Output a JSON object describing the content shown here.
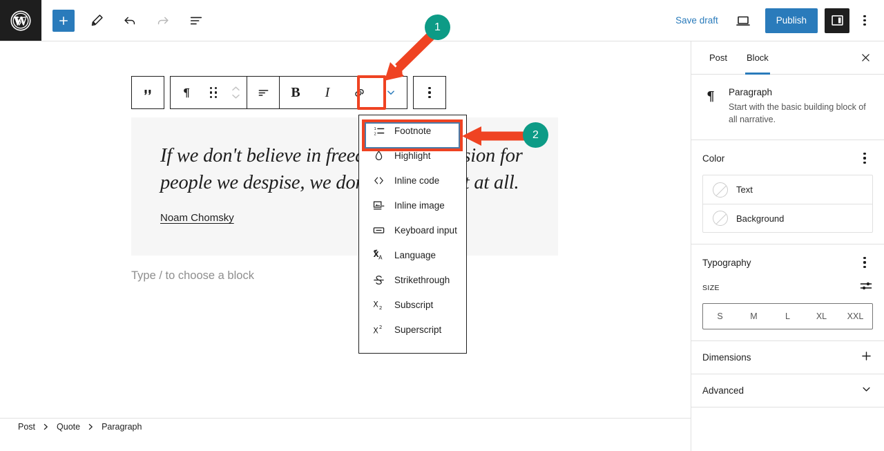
{
  "topbar": {
    "logo_icon": "wordpress-logo-icon",
    "add_block_label": "+",
    "tools": [
      {
        "name": "edit-tool",
        "icon": "pencil-icon"
      },
      {
        "name": "undo",
        "icon": "undo-arrow-icon"
      },
      {
        "name": "redo",
        "icon": "redo-arrow-icon"
      },
      {
        "name": "document-overview",
        "icon": "list-view-icon"
      }
    ],
    "save_draft_label": "Save draft",
    "preview_icon": "laptop-preview-icon",
    "publish_label": "Publish",
    "sidebar_toggle_icon": "settings-panel-icon",
    "options_icon": "kebab-vertical-icon"
  },
  "block_toolbar": {
    "parent_block_icon": "quote-icon",
    "block_type_icon": "paragraph-pilcrow-icon",
    "drag_icon": "drag-handle-icon",
    "movers_icon": "move-up-down-icon",
    "align_icon": "align-text-icon",
    "bold_label": "B",
    "italic_label": "I",
    "link_icon": "link-icon",
    "more_formats_icon": "chevron-down-icon",
    "options_icon": "kebab-vertical-icon"
  },
  "dropdown": {
    "items": [
      {
        "label": "Footnote",
        "icon": "ordered-list-icon",
        "selected": true
      },
      {
        "label": "Highlight",
        "icon": "droplet-icon",
        "selected": false
      },
      {
        "label": "Inline code",
        "icon": "angle-brackets-icon",
        "selected": false
      },
      {
        "label": "Inline image",
        "icon": "inline-image-icon",
        "selected": false
      },
      {
        "label": "Keyboard input",
        "icon": "keyboard-icon",
        "selected": false
      },
      {
        "label": "Language",
        "icon": "language-icon",
        "selected": false
      },
      {
        "label": "Strikethrough",
        "icon": "strikethrough-icon",
        "selected": false
      },
      {
        "label": "Subscript",
        "icon": "subscript-icon",
        "selected": false
      },
      {
        "label": "Superscript",
        "icon": "superscript-icon",
        "selected": false
      }
    ]
  },
  "editor": {
    "quote_text": "If we don't believe in freedom of expression for people we despise, we don't believe in it at all.",
    "quote_citation": "Noam Chomsky",
    "empty_paragraph_placeholder": "Type / to choose a block"
  },
  "sidebar": {
    "tabs": [
      {
        "label": "Post",
        "active": false
      },
      {
        "label": "Block",
        "active": true
      }
    ],
    "close_icon": "close-x-icon",
    "block_info": {
      "icon": "paragraph-pilcrow-icon",
      "title": "Paragraph",
      "description": "Start with the basic building block of all narrative."
    },
    "color_panel": {
      "title": "Color",
      "options_icon": "kebab-vertical-icon",
      "rows": [
        {
          "label": "Text"
        },
        {
          "label": "Background"
        }
      ]
    },
    "typography_panel": {
      "title": "Typography",
      "options_icon": "kebab-vertical-icon",
      "size_label": "SIZE",
      "size_settings_icon": "sliders-icon",
      "sizes": [
        "S",
        "M",
        "L",
        "XL",
        "XXL"
      ]
    },
    "dimensions_panel": {
      "title": "Dimensions",
      "toggle_icon": "plus-icon"
    },
    "advanced_panel": {
      "title": "Advanced",
      "toggle_icon": "chevron-down-icon"
    }
  },
  "breadcrumb": {
    "separator": "›",
    "items": [
      {
        "label": "Post"
      },
      {
        "label": "Quote"
      },
      {
        "label": "Paragraph"
      }
    ]
  },
  "annotations": {
    "badges": [
      {
        "number": "1"
      },
      {
        "number": "2"
      }
    ],
    "badge_color": "#0d9b86",
    "arrow_color": "#ef4322",
    "highlight_color": "#ef4322"
  }
}
